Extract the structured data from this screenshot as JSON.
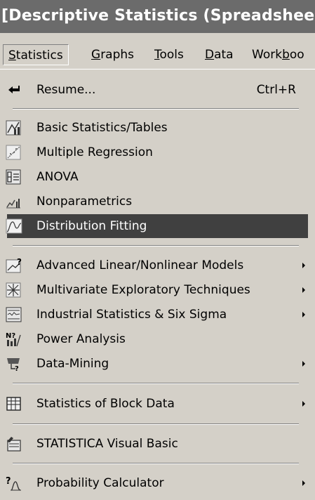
{
  "window": {
    "title": "[Descriptive Statistics (Spreadshee"
  },
  "menubar": {
    "items": [
      {
        "label": "Statistics",
        "accel": "S"
      },
      {
        "label": "Graphs",
        "accel": "G"
      },
      {
        "label": "Tools",
        "accel": "T"
      },
      {
        "label": "Data",
        "accel": "D"
      },
      {
        "label": "Workboo",
        "accel": "b"
      }
    ]
  },
  "menu": {
    "resume": {
      "label": "Resume...",
      "shortcut": "Ctrl+R",
      "icon": "resume-arrow-icon"
    },
    "basic_statistics": {
      "label": "Basic Statistics/Tables",
      "icon": "basic-stats-icon"
    },
    "multiple_regression": {
      "label": "Multiple Regression",
      "icon": "regression-icon"
    },
    "anova": {
      "label": "ANOVA",
      "icon": "anova-icon"
    },
    "nonparametrics": {
      "label": "Nonparametrics",
      "icon": "nonparametrics-icon"
    },
    "distribution_fitting": {
      "label": "Distribution Fitting",
      "icon": "distribution-icon",
      "highlighted": true
    },
    "advanced_models": {
      "label": "Advanced Linear/Nonlinear Models",
      "icon": "advanced-models-icon",
      "submenu": true
    },
    "multivariate": {
      "label": "Multivariate Exploratory Techniques",
      "icon": "multivariate-icon",
      "submenu": true
    },
    "industrial": {
      "label": "Industrial Statistics & Six Sigma",
      "icon": "industrial-icon",
      "submenu": true
    },
    "power_analysis": {
      "label": "Power Analysis",
      "icon": "power-analysis-icon"
    },
    "data_mining": {
      "label": "Data-Mining",
      "icon": "data-mining-icon",
      "submenu": true
    },
    "block_data": {
      "label": "Statistics of Block Data",
      "icon": "block-data-icon",
      "submenu": true
    },
    "visual_basic": {
      "label": "STATISTICA Visual Basic",
      "icon": "visual-basic-icon"
    },
    "probability_calculator": {
      "label": "Probability Calculator",
      "icon": "probability-icon",
      "submenu": true
    }
  },
  "colors": {
    "menu_bg": "#d4d0c8",
    "titlebar_bg": "#6b6b6b",
    "highlight_bg": "#404040",
    "highlight_text": "#ffffff"
  }
}
